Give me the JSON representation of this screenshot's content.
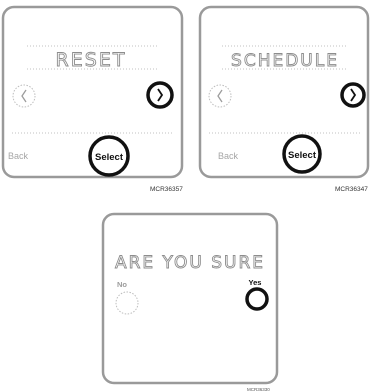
{
  "panels": [
    {
      "display_text": "RESET",
      "back_label": "Back",
      "select_label": "Select",
      "figure_code": "MCR36357"
    },
    {
      "display_text": "SCHEDULE",
      "back_label": "Back",
      "select_label": "Select",
      "figure_code": "MCR36347"
    },
    {
      "display_text": "ARE YOU SURE",
      "no_label": "No",
      "yes_label": "Yes",
      "figure_code": "MCR36330"
    }
  ],
  "icons": {
    "prev": "chevron-left-icon",
    "next": "chevron-right-icon"
  },
  "colors": {
    "frame": "#9a9a9a",
    "segment_text": "#8d8d8d",
    "highlight_ring": "#111111",
    "inactive": "#a6a6a6"
  }
}
